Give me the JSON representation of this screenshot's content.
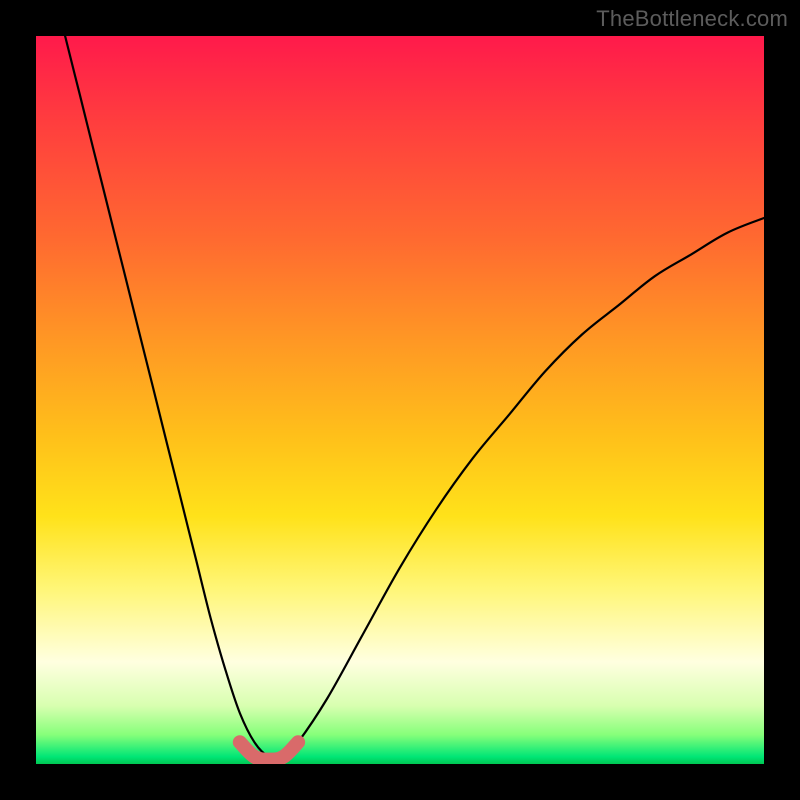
{
  "watermark": "TheBottleneck.com",
  "chart_data": {
    "type": "line",
    "title": "",
    "xlabel": "",
    "ylabel": "",
    "xlim": [
      0,
      100
    ],
    "ylim": [
      0,
      100
    ],
    "series": [
      {
        "name": "bottleneck-curve",
        "x": [
          4,
          6,
          8,
          10,
          12,
          14,
          16,
          18,
          20,
          22,
          24,
          26,
          28,
          30,
          32,
          34,
          36,
          40,
          45,
          50,
          55,
          60,
          65,
          70,
          75,
          80,
          85,
          90,
          95,
          100
        ],
        "y": [
          100,
          92,
          84,
          76,
          68,
          60,
          52,
          44,
          36,
          28,
          20,
          13,
          7,
          3,
          1,
          1,
          3,
          9,
          18,
          27,
          35,
          42,
          48,
          54,
          59,
          63,
          67,
          70,
          73,
          75
        ]
      },
      {
        "name": "min-highlight",
        "x": [
          28,
          30,
          32,
          34,
          36
        ],
        "y": [
          3,
          1,
          0.6,
          1,
          3
        ]
      }
    ],
    "notes": "Values estimated from pixel positions; y expressed as percent of plot height (0 = bottom, 100 = top)."
  }
}
